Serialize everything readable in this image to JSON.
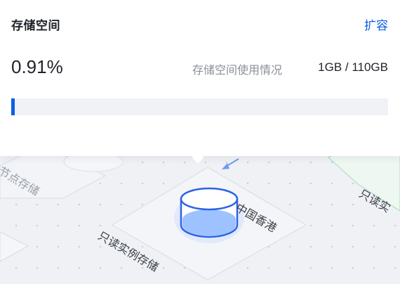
{
  "storage_panel": {
    "title": "存储空间",
    "expand_label": "扩容",
    "usage_percent_text": "0.91%",
    "usage_label": "存储空间使用情况",
    "usage_value": "1GB / 110GB",
    "usage_fraction": 0.0091
  },
  "diagram": {
    "region_label": "中国香港",
    "readonly_storage_label": "只读实例存储",
    "readonly_instance_label": "只读实",
    "node_storage_label": "节点存储",
    "accent_color": "#0a5fe6",
    "cylinder_fill": "#9ec2ff"
  }
}
